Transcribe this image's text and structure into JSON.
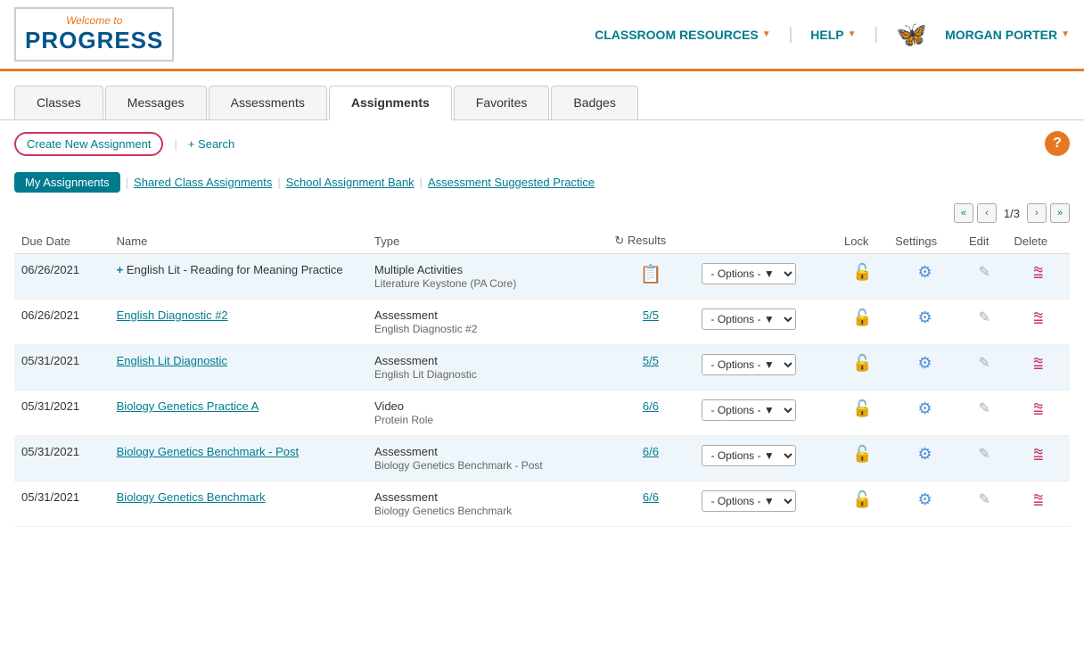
{
  "header": {
    "logo": {
      "welcome": "Welcome to",
      "progress": "PROGRESS"
    },
    "nav": [
      {
        "label": "CLASSROOM RESOURCES",
        "id": "classroom-resources"
      },
      {
        "label": "HELP",
        "id": "help"
      },
      {
        "label": "MORGAN PORTER",
        "id": "user-menu"
      }
    ]
  },
  "tabs": [
    {
      "label": "Classes",
      "id": "tab-classes",
      "active": false
    },
    {
      "label": "Messages",
      "id": "tab-messages",
      "active": false
    },
    {
      "label": "Assessments",
      "id": "tab-assessments",
      "active": false
    },
    {
      "label": "Assignments",
      "id": "tab-assignments",
      "active": true
    },
    {
      "label": "Favorites",
      "id": "tab-favorites",
      "active": false
    },
    {
      "label": "Badges",
      "id": "tab-badges",
      "active": false
    }
  ],
  "action_bar": {
    "create_label": "Create New Assignment",
    "search_label": "+ Search",
    "help_label": "?"
  },
  "sub_nav": {
    "items": [
      {
        "label": "My Assignments",
        "active": true
      },
      {
        "label": "Shared Class Assignments",
        "active": false
      },
      {
        "label": "School Assignment Bank",
        "active": false
      },
      {
        "label": "Assessment Suggested Practice",
        "active": false
      }
    ]
  },
  "pagination": {
    "current": "1/3",
    "first": "«",
    "prev": "‹",
    "next": "›",
    "last": "»"
  },
  "table": {
    "headers": [
      "Due Date",
      "Name",
      "Type",
      "Results",
      "Lock",
      "Settings",
      "Edit",
      "Delete"
    ],
    "rows": [
      {
        "due_date": "06/26/2021",
        "name": "+ English Lit - Reading for Meaning Practice",
        "name_link": false,
        "name_plus": true,
        "type_main": "Multiple Activities",
        "type_sub": "Literature Keystone (PA Core)",
        "results_value": "",
        "results_icon": true,
        "options": "- Options -",
        "id": "row-1"
      },
      {
        "due_date": "06/26/2021",
        "name": "English Diagnostic #2",
        "name_link": true,
        "name_plus": false,
        "type_main": "Assessment",
        "type_sub": "English Diagnostic #2",
        "results_value": "5/5",
        "results_icon": false,
        "options": "- Options -",
        "id": "row-2"
      },
      {
        "due_date": "05/31/2021",
        "name": "English Lit Diagnostic",
        "name_link": true,
        "name_plus": false,
        "type_main": "Assessment",
        "type_sub": "English Lit Diagnostic",
        "results_value": "5/5",
        "results_icon": false,
        "options": "- Options -",
        "id": "row-3"
      },
      {
        "due_date": "05/31/2021",
        "name": "Biology Genetics Practice A",
        "name_link": true,
        "name_plus": false,
        "type_main": "Video",
        "type_sub": "Protein Role",
        "results_value": "6/6",
        "results_icon": false,
        "options": "- Options -",
        "id": "row-4"
      },
      {
        "due_date": "05/31/2021",
        "name": "Biology Genetics Benchmark - Post",
        "name_link": true,
        "name_plus": false,
        "type_main": "Assessment",
        "type_sub": "Biology Genetics Benchmark - Post",
        "results_value": "6/6",
        "results_icon": false,
        "options": "- Options -",
        "id": "row-5"
      },
      {
        "due_date": "05/31/2021",
        "name": "Biology Genetics Benchmark",
        "name_link": true,
        "name_plus": false,
        "type_main": "Assessment",
        "type_sub": "Biology Genetics Benchmark",
        "results_value": "6/6",
        "results_icon": false,
        "options": "- Options -",
        "id": "row-6"
      }
    ]
  },
  "colors": {
    "teal": "#007b8e",
    "orange": "#e87722",
    "pink": "#cc3366",
    "blue": "#4a90d9",
    "light_blue_row": "#eef6fb"
  }
}
